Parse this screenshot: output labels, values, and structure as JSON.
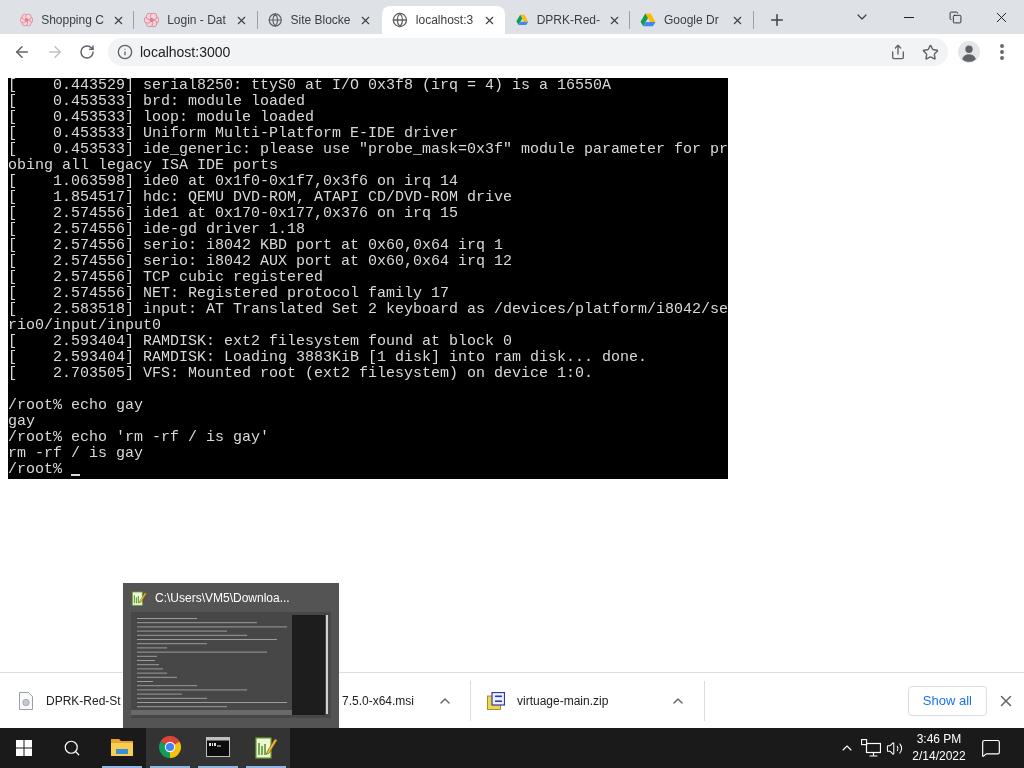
{
  "tabs": [
    {
      "title": "Shopping C",
      "kind": "flower",
      "selected": false
    },
    {
      "title": "Login - Dat",
      "kind": "flower",
      "selected": false
    },
    {
      "title": "Site Blocke",
      "kind": "globe",
      "selected": false
    },
    {
      "title": "localhost:3",
      "kind": "globe",
      "selected": true
    },
    {
      "title": "DPRK-Red-",
      "kind": "drive",
      "selected": false
    },
    {
      "title": "Google Dr",
      "kind": "drive",
      "selected": false
    }
  ],
  "toolbar": {
    "forward_disabled": true,
    "url": "localhost:3000"
  },
  "terminal": {
    "boot_log": [
      "[    0.443529] serial8250: ttyS0 at I/O 0x3f8 (irq = 4) is a 16550A",
      "[    0.453533] brd: module loaded",
      "[    0.453533] loop: module loaded",
      "[    0.453533] Uniform Multi-Platform E-IDE driver",
      "[    0.453533] ide_generic: please use \"probe_mask=0x3f\" module parameter for pr",
      "obing all legacy ISA IDE ports",
      "[    1.063598] ide0 at 0x1f0-0x1f7,0x3f6 on irq 14",
      "[    1.854517] hdc: QEMU DVD-ROM, ATAPI CD/DVD-ROM drive",
      "[    2.574556] ide1 at 0x170-0x177,0x376 on irq 15",
      "[    2.574556] ide-gd driver 1.18",
      "[    2.574556] serio: i8042 KBD port at 0x60,0x64 irq 1",
      "[    2.574556] serio: i8042 AUX port at 0x60,0x64 irq 12",
      "[    2.574556] TCP cubic registered",
      "[    2.574556] NET: Registered protocol family 17",
      "[    2.583518] input: AT Translated Set 2 keyboard as /devices/platform/i8042/se",
      "rio0/input/input0",
      "[    2.593404] RAMDISK: ext2 filesystem found at block 0",
      "[    2.593404] RAMDISK: Loading 3883KiB [1 disk] into ram disk... done.",
      "[    2.703505] VFS: Mounted root (ext2 filesystem) on device 1:0."
    ],
    "session": [
      "/root% echo gay",
      "gay",
      "/root% echo 'rm -rf / is gay'",
      "rm -rf / is gay",
      "/root%"
    ],
    "cursor": true
  },
  "downloads": {
    "items": [
      {
        "kind": "file",
        "name_parts": [
          "DPRK-Red-St",
          "7.5.0-x64.msi"
        ]
      },
      {
        "kind": "archive",
        "name_parts": [
          "virtuage-main.zip"
        ]
      }
    ],
    "show_all": "Show all"
  },
  "window_preview": {
    "title": "C:\\Users\\VM5\\Downloa..."
  },
  "taskbar": {
    "apps": [
      {
        "kind": "explorer",
        "running": true,
        "highlighted": false
      },
      {
        "kind": "chrome",
        "running": true,
        "highlighted": true
      },
      {
        "kind": "terminal",
        "running": true,
        "highlighted": true
      },
      {
        "kind": "notepad",
        "running": true,
        "highlighted": true
      }
    ],
    "clock": {
      "time": "3:46 PM",
      "date": "2/14/2022"
    }
  }
}
